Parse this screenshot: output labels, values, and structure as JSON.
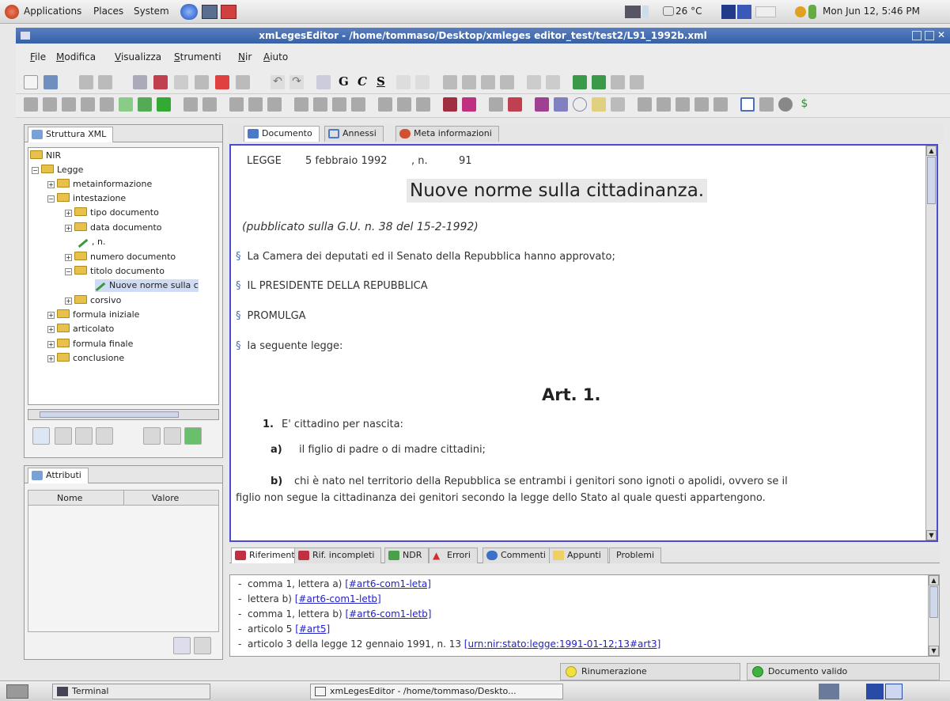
{
  "panel": {
    "menus": [
      "Applications",
      "Places",
      "System"
    ],
    "weather": "26 °C",
    "clock": "Mon Jun 12,  5:46 PM"
  },
  "window": {
    "title": "xmLegesEditor - /home/tommaso/Desktop/xmleges editor_test/test2/L91_1992b.xml"
  },
  "menubar": [
    "File",
    "Modifica",
    "Visualizza",
    "Strumenti",
    "Nir",
    "Aiuto"
  ],
  "toolbar": {
    "bold": "G",
    "italic": "C",
    "underline": "S"
  },
  "left": {
    "tab": "Struttura XML",
    "tree": [
      "NIR",
      "Legge",
      "metainformazione",
      "intestazione",
      "tipo documento",
      "data documento",
      ", n.",
      "numero documento",
      "titolo documento",
      "Nuove norme sulla c",
      "corsivo",
      "formula iniziale",
      "articolato",
      "formula finale",
      "conclusione"
    ],
    "attr_tab": "Attributi",
    "attr_cols": [
      "Nome",
      "Valore"
    ]
  },
  "doc": {
    "tabs": [
      "Documento",
      "Annessi",
      "Meta informazioni"
    ],
    "header": {
      "type": "LEGGE",
      "date": "5 febbraio 1992",
      "sep": ", n.",
      "num": "91"
    },
    "title": "Nuove norme sulla cittadinanza.",
    "pub": "(pubblicato sulla G.U. n. 38 del 15-2-1992)",
    "sect_mark": "§",
    "paras": [
      "La Camera dei deputati ed il Senato della Repubblica hanno approvato;",
      "IL PRESIDENTE DELLA REPUBBLICA",
      "PROMULGA",
      "la seguente legge:"
    ],
    "art": "Art. 1.",
    "c1_num": "1.",
    "c1_text": "E' cittadino per nascita:",
    "la": "a)",
    "la_text": "il figlio di padre o di madre cittadini;",
    "lb": "b)",
    "lb_text1": "chi è nato nel territorio della Repubblica se entrambi i genitori sono ignoti o apolidi, ovvero se il",
    "lb_text2": "figlio non segue la cittadinanza dei genitori secondo la legge dello Stato al quale questi appartengono."
  },
  "bottom": {
    "tabs": [
      "Riferimenti",
      "Rif. incompleti",
      "NDR",
      "Errori",
      "Commenti",
      "Appunti",
      "Problemi"
    ],
    "refs": [
      {
        "t": "comma 1, lettera a) ",
        "l": "[#art6-com1-leta]"
      },
      {
        "t": "lettera b) ",
        "l": "[#art6-com1-letb]"
      },
      {
        "t": "comma 1, lettera b) ",
        "l": "[#art6-com1-letb]"
      },
      {
        "t": "articolo 5 ",
        "l": "[#art5]"
      },
      {
        "t": "articolo 3 della legge 12 gennaio 1991, n. 13 ",
        "l": "[urn:nir:stato:legge:1991-01-12;13#art3]"
      }
    ]
  },
  "status": {
    "renum": "Rinumerazione",
    "valid": "Documento valido"
  },
  "taskbar": {
    "terminal": "Terminal",
    "editor": "xmLegesEditor - /home/tommaso/Deskto..."
  },
  "colors": {
    "title_bar": "#3560a8",
    "doc_border": "#4b4bd2",
    "link": "#2222cc"
  }
}
